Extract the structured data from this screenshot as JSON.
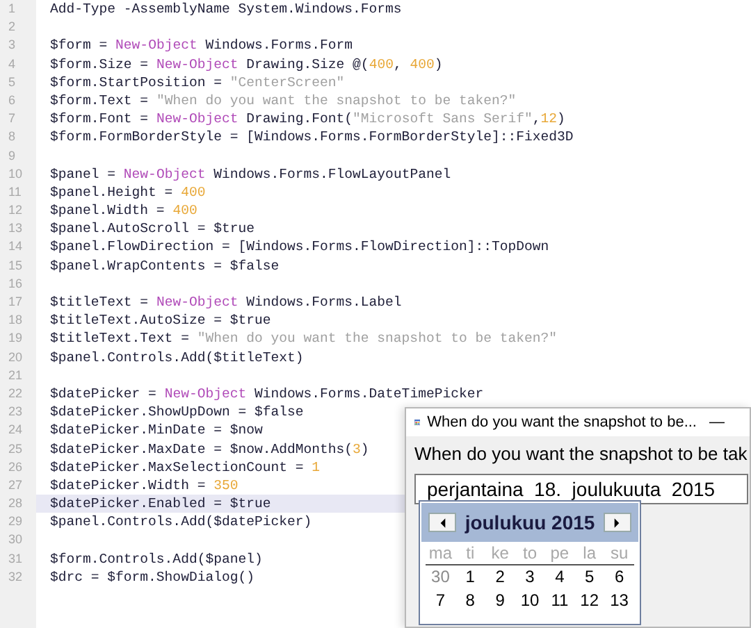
{
  "editor": {
    "lines": [
      {
        "number": "1",
        "current": false,
        "segments": [
          {
            "kind": "plain",
            "text": "Add-Type -AssemblyName System.Windows.Forms"
          }
        ]
      },
      {
        "number": "2",
        "current": false
      },
      {
        "number": "3",
        "current": false,
        "segments": [
          {
            "kind": "plain",
            "text": "$form = "
          },
          {
            "kind": "keyword",
            "text": "New-Object"
          },
          {
            "kind": "plain",
            "text": " Windows.Forms.Form"
          }
        ]
      },
      {
        "number": "4",
        "current": false,
        "segments": [
          {
            "kind": "plain",
            "text": "$form.Size = "
          },
          {
            "kind": "keyword",
            "text": "New-Object"
          },
          {
            "kind": "plain",
            "text": " Drawing.Size @("
          },
          {
            "kind": "number",
            "text": "400"
          },
          {
            "kind": "plain",
            "text": ", "
          },
          {
            "kind": "number",
            "text": "400"
          },
          {
            "kind": "plain",
            "text": ")"
          }
        ]
      },
      {
        "number": "5",
        "current": false,
        "segments": [
          {
            "kind": "plain",
            "text": "$form.StartPosition = "
          },
          {
            "kind": "string",
            "text": "\"CenterScreen\""
          }
        ]
      },
      {
        "number": "6",
        "current": false,
        "segments": [
          {
            "kind": "plain",
            "text": "$form.Text = "
          },
          {
            "kind": "string",
            "text": "\"When do you want the snapshot to be taken?\""
          }
        ]
      },
      {
        "number": "7",
        "current": false,
        "segments": [
          {
            "kind": "plain",
            "text": "$form.Font = "
          },
          {
            "kind": "keyword",
            "text": "New-Object"
          },
          {
            "kind": "plain",
            "text": " Drawing.Font("
          },
          {
            "kind": "string",
            "text": "\"Microsoft Sans Serif\""
          },
          {
            "kind": "plain",
            "text": ","
          },
          {
            "kind": "number",
            "text": "12"
          },
          {
            "kind": "plain",
            "text": ")"
          }
        ]
      },
      {
        "number": "8",
        "current": false,
        "segments": [
          {
            "kind": "plain",
            "text": "$form.FormBorderStyle = [Windows.Forms.FormBorderStyle]::Fixed3D"
          }
        ]
      },
      {
        "number": "9",
        "current": false
      },
      {
        "number": "10",
        "current": false,
        "segments": [
          {
            "kind": "plain",
            "text": "$panel = "
          },
          {
            "kind": "keyword",
            "text": "New-Object"
          },
          {
            "kind": "plain",
            "text": " Windows.Forms.FlowLayoutPanel"
          }
        ]
      },
      {
        "number": "11",
        "current": false,
        "segments": [
          {
            "kind": "plain",
            "text": "$panel.Height = "
          },
          {
            "kind": "number",
            "text": "400"
          }
        ]
      },
      {
        "number": "12",
        "current": false,
        "segments": [
          {
            "kind": "plain",
            "text": "$panel.Width = "
          },
          {
            "kind": "number",
            "text": "400"
          }
        ]
      },
      {
        "number": "13",
        "current": false,
        "segments": [
          {
            "kind": "plain",
            "text": "$panel.AutoScroll = $true"
          }
        ]
      },
      {
        "number": "14",
        "current": false,
        "segments": [
          {
            "kind": "plain",
            "text": "$panel.FlowDirection = [Windows.Forms.FlowDirection]::TopDown"
          }
        ]
      },
      {
        "number": "15",
        "current": false,
        "segments": [
          {
            "kind": "plain",
            "text": "$panel.WrapContents = $false"
          }
        ]
      },
      {
        "number": "16",
        "current": false
      },
      {
        "number": "17",
        "current": false,
        "segments": [
          {
            "kind": "plain",
            "text": "$titleText = "
          },
          {
            "kind": "keyword",
            "text": "New-Object"
          },
          {
            "kind": "plain",
            "text": " Windows.Forms.Label"
          }
        ]
      },
      {
        "number": "18",
        "current": false,
        "segments": [
          {
            "kind": "plain",
            "text": "$titleText.AutoSize = $true"
          }
        ]
      },
      {
        "number": "19",
        "current": false,
        "segments": [
          {
            "kind": "plain",
            "text": "$titleText.Text = "
          },
          {
            "kind": "string",
            "text": "\"When do you want the snapshot to be taken?\""
          }
        ]
      },
      {
        "number": "20",
        "current": false,
        "segments": [
          {
            "kind": "plain",
            "text": "$panel.Controls.Add($titleText)"
          }
        ]
      },
      {
        "number": "21",
        "current": false
      },
      {
        "number": "22",
        "current": false,
        "segments": [
          {
            "kind": "plain",
            "text": "$datePicker = "
          },
          {
            "kind": "keyword",
            "text": "New-Object"
          },
          {
            "kind": "plain",
            "text": " Windows.Forms.DateTimePicker"
          }
        ]
      },
      {
        "number": "23",
        "current": false,
        "segments": [
          {
            "kind": "plain",
            "text": "$datePicker.ShowUpDown = $false"
          }
        ]
      },
      {
        "number": "24",
        "current": false,
        "segments": [
          {
            "kind": "plain",
            "text": "$datePicker.MinDate = $now"
          }
        ]
      },
      {
        "number": "25",
        "current": false,
        "segments": [
          {
            "kind": "plain",
            "text": "$datePicker.MaxDate = $now.AddMonths("
          },
          {
            "kind": "number",
            "text": "3"
          },
          {
            "kind": "plain",
            "text": ")"
          }
        ]
      },
      {
        "number": "26",
        "current": false,
        "segments": [
          {
            "kind": "plain",
            "text": "$datePicker.MaxSelectionCount = "
          },
          {
            "kind": "number",
            "text": "1"
          }
        ]
      },
      {
        "number": "27",
        "current": false,
        "segments": [
          {
            "kind": "plain",
            "text": "$datePicker.Width = "
          },
          {
            "kind": "number",
            "text": "350"
          }
        ]
      },
      {
        "number": "28",
        "current": true,
        "segments": [
          {
            "kind": "plain",
            "text": "$datePicker.Enabled = $true"
          }
        ]
      },
      {
        "number": "29",
        "current": false,
        "segments": [
          {
            "kind": "plain",
            "text": "$panel.Controls.Add($datePicker)"
          }
        ]
      },
      {
        "number": "30",
        "current": false
      },
      {
        "number": "31",
        "current": false,
        "segments": [
          {
            "kind": "plain",
            "text": "$form.Controls.Add($panel)"
          }
        ]
      },
      {
        "number": "32",
        "current": false,
        "segments": [
          {
            "kind": "plain",
            "text": "$drc = $form.ShowDialog()"
          }
        ]
      }
    ]
  },
  "dialog": {
    "title": "When do you want the snapshot to be...",
    "minimize": "—",
    "label": "When do you want the snapshot to be tak",
    "date_field": {
      "value": "perjantaina  18.  joulukuuta  2015"
    },
    "calendar": {
      "month": "joulukuu 2015",
      "weekdays": [
        "ma",
        "ti",
        "ke",
        "to",
        "pe",
        "la",
        "su"
      ],
      "weeks": [
        [
          {
            "day": "30",
            "other_month": true
          },
          {
            "day": "1",
            "other_month": false
          },
          {
            "day": "2",
            "other_month": false
          },
          {
            "day": "3",
            "other_month": false
          },
          {
            "day": "4",
            "other_month": false
          },
          {
            "day": "5",
            "other_month": false
          },
          {
            "day": "6",
            "other_month": false
          }
        ],
        [
          {
            "day": "7",
            "other_month": false
          },
          {
            "day": "8",
            "other_month": false
          },
          {
            "day": "9",
            "other_month": false
          },
          {
            "day": "10",
            "other_month": false
          },
          {
            "day": "11",
            "other_month": false
          },
          {
            "day": "12",
            "other_month": false
          },
          {
            "day": "13",
            "other_month": false
          }
        ]
      ]
    }
  }
}
